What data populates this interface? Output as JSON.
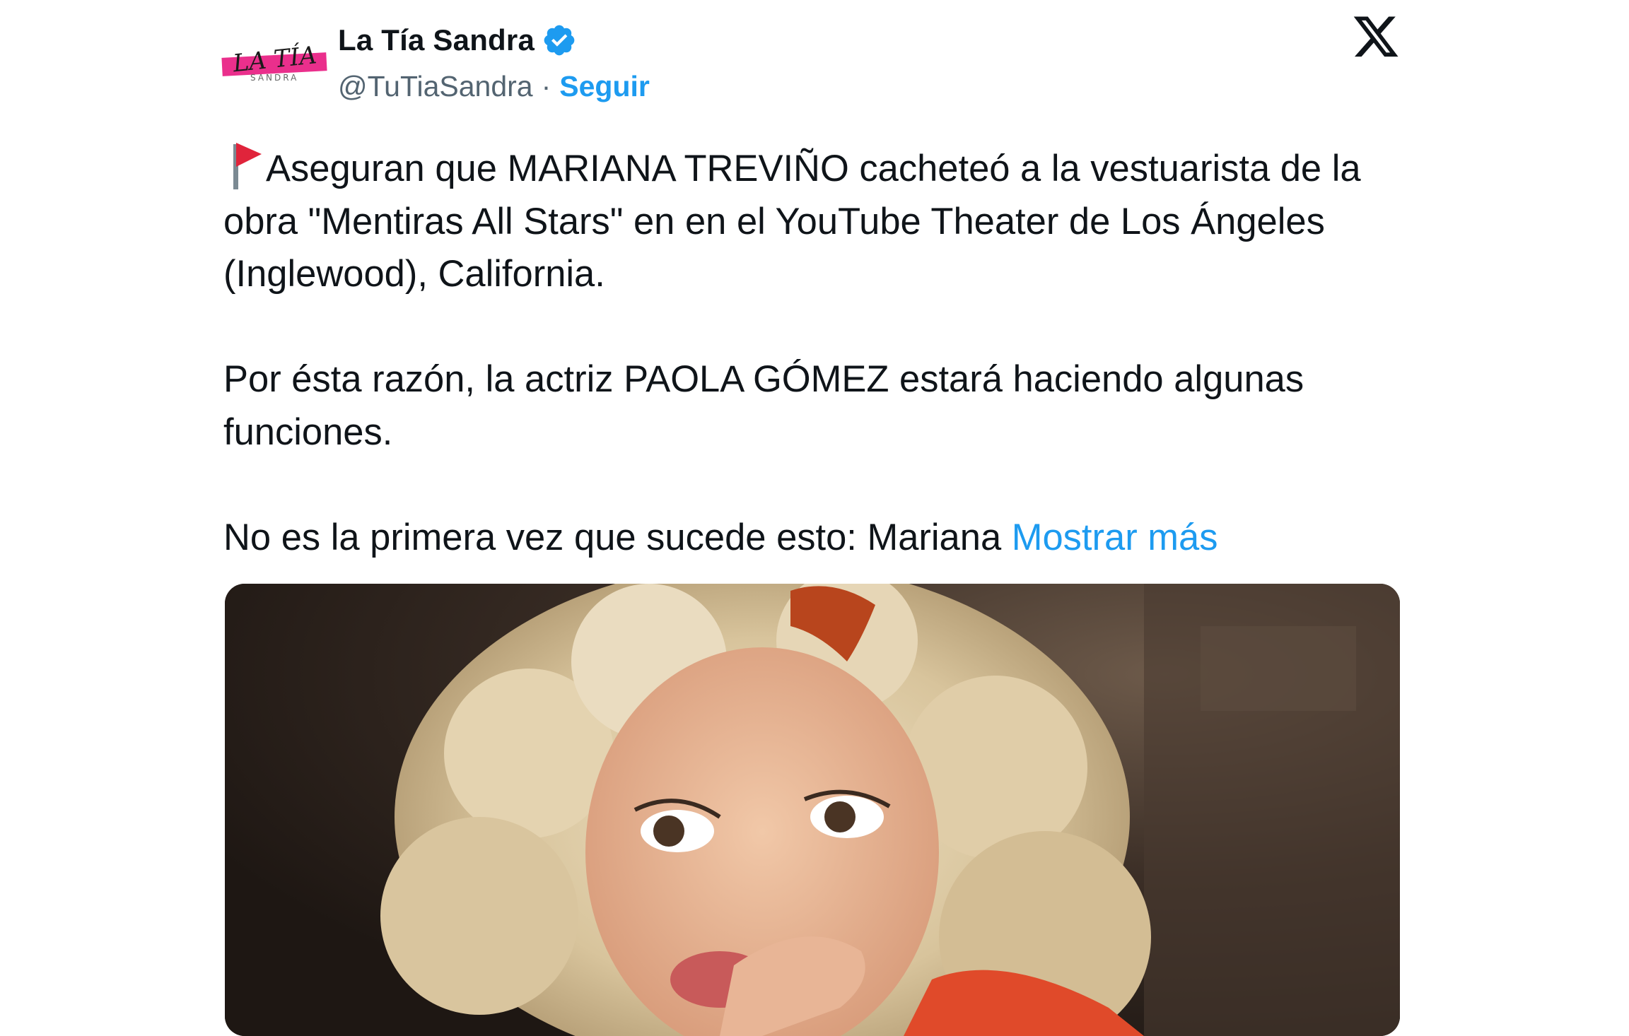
{
  "author": {
    "avatar_text": "LA TÍA",
    "avatar_subtext": "SANDRA",
    "display_name": "La Tía Sandra",
    "handle": "@TuTiaSandra",
    "separator": "·",
    "follow_label": "Seguir",
    "verified": true
  },
  "tweet": {
    "paragraphs": [
      "Aseguran que MARIANA TREVIÑO cacheteó a la vestuarista de la obra \"Mentiras All Stars\" en en el YouTube Theater de Los Ángeles (Inglewood), California.",
      "Por ésta razón, la actriz PAOLA GÓMEZ estará haciendo algunas funciones.",
      "No es la primera vez que sucede esto: Mariana"
    ],
    "show_more_label": "Mostrar más"
  },
  "icons": {
    "flag": "red-flag-icon",
    "verified": "verified-badge-icon",
    "platform": "x-logo-icon"
  },
  "colors": {
    "accent": "#1d9bf0",
    "text": "#0f1419",
    "secondary": "#536471",
    "avatar_pink": "#ea2f8c"
  }
}
